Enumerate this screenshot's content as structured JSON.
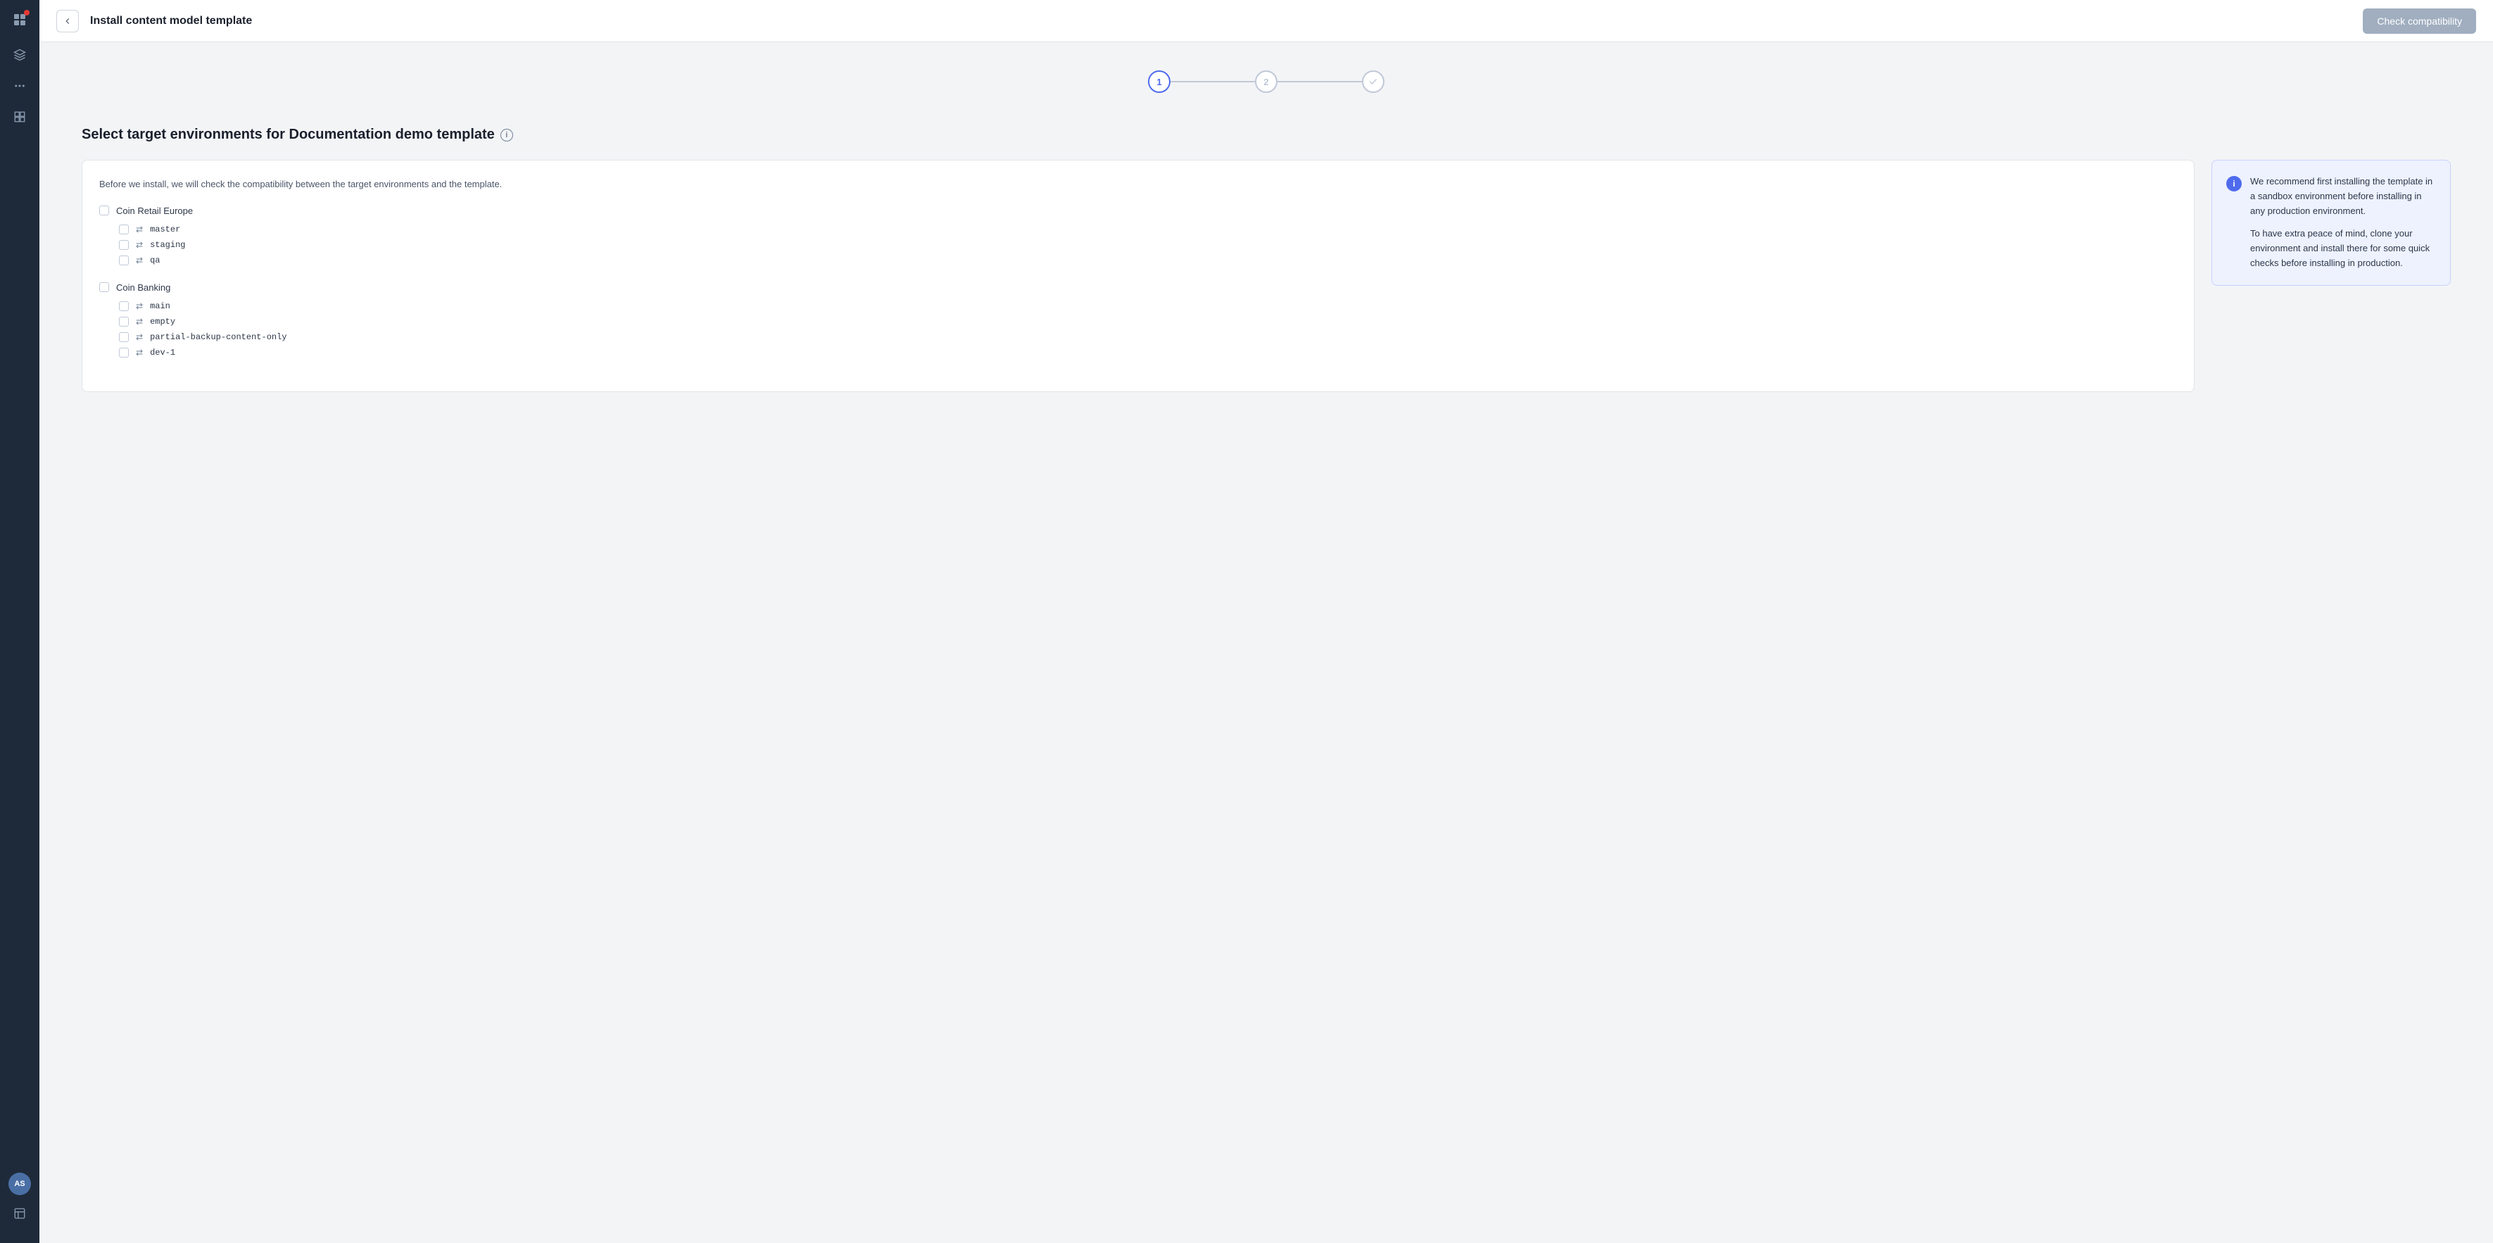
{
  "sidebar": {
    "logo_icon": "grid",
    "avatar_initials": "AS",
    "nav_icons": [
      "cube",
      "dots",
      "grid-2x2",
      "layers"
    ]
  },
  "header": {
    "title": "Install content model template",
    "check_compat_label": "Check compatibility",
    "back_tooltip": "Back"
  },
  "stepper": {
    "step1_label": "1",
    "step2_label": "2",
    "step3_symbol": "✓"
  },
  "page": {
    "title": "Select target environments for Documentation demo template",
    "description": "Before we install, we will check the compatibility between the target environments and the template.",
    "orgs": [
      {
        "name": "Coin Retail Europe",
        "environments": [
          {
            "name": "master"
          },
          {
            "name": "staging"
          },
          {
            "name": "qa"
          }
        ]
      },
      {
        "name": "Coin Banking",
        "environments": [
          {
            "name": "main"
          },
          {
            "name": "empty"
          },
          {
            "name": "partial-backup-content-only"
          },
          {
            "name": "dev-1"
          }
        ]
      }
    ]
  },
  "info_panel": {
    "para1": "We recommend first installing the template in a sandbox environment before installing in any production environment.",
    "para2": "To have extra peace of mind, clone your environment and install there for some quick checks before installing in production."
  }
}
